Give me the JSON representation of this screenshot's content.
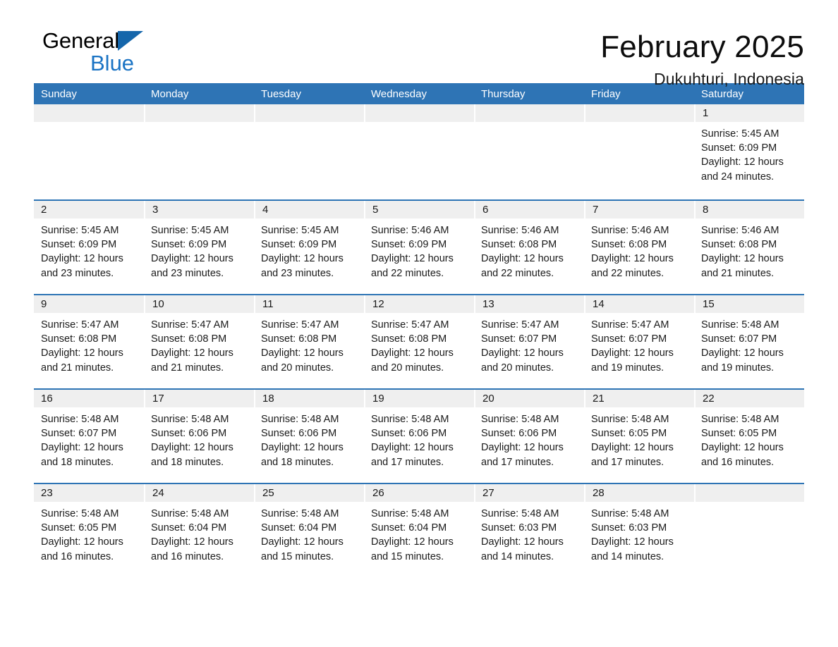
{
  "brand": {
    "name_part1": "General",
    "name_part2": "Blue",
    "triangle_color": "#1566ab",
    "blue_color": "#1a73c4"
  },
  "header": {
    "title": "February 2025",
    "subtitle": "Dukuhturi, Indonesia"
  },
  "theme": {
    "header_blue": "#2e74b5",
    "date_strip_gray": "#efefef",
    "text": "#1a1a1a"
  },
  "weekdays": [
    "Sunday",
    "Monday",
    "Tuesday",
    "Wednesday",
    "Thursday",
    "Friday",
    "Saturday"
  ],
  "labels": {
    "sunrise_prefix": "Sunrise:",
    "sunset_prefix": "Sunset:",
    "daylight_prefix": "Daylight:"
  },
  "weeks": [
    [
      {
        "date": "",
        "empty": true
      },
      {
        "date": "",
        "empty": true
      },
      {
        "date": "",
        "empty": true
      },
      {
        "date": "",
        "empty": true
      },
      {
        "date": "",
        "empty": true
      },
      {
        "date": "",
        "empty": true
      },
      {
        "date": "1",
        "sunrise": "Sunrise: 5:45 AM",
        "sunset": "Sunset: 6:09 PM",
        "daylight1": "Daylight: 12 hours",
        "daylight2": "and 24 minutes."
      }
    ],
    [
      {
        "date": "2",
        "sunrise": "Sunrise: 5:45 AM",
        "sunset": "Sunset: 6:09 PM",
        "daylight1": "Daylight: 12 hours",
        "daylight2": "and 23 minutes."
      },
      {
        "date": "3",
        "sunrise": "Sunrise: 5:45 AM",
        "sunset": "Sunset: 6:09 PM",
        "daylight1": "Daylight: 12 hours",
        "daylight2": "and 23 minutes."
      },
      {
        "date": "4",
        "sunrise": "Sunrise: 5:45 AM",
        "sunset": "Sunset: 6:09 PM",
        "daylight1": "Daylight: 12 hours",
        "daylight2": "and 23 minutes."
      },
      {
        "date": "5",
        "sunrise": "Sunrise: 5:46 AM",
        "sunset": "Sunset: 6:09 PM",
        "daylight1": "Daylight: 12 hours",
        "daylight2": "and 22 minutes."
      },
      {
        "date": "6",
        "sunrise": "Sunrise: 5:46 AM",
        "sunset": "Sunset: 6:08 PM",
        "daylight1": "Daylight: 12 hours",
        "daylight2": "and 22 minutes."
      },
      {
        "date": "7",
        "sunrise": "Sunrise: 5:46 AM",
        "sunset": "Sunset: 6:08 PM",
        "daylight1": "Daylight: 12 hours",
        "daylight2": "and 22 minutes."
      },
      {
        "date": "8",
        "sunrise": "Sunrise: 5:46 AM",
        "sunset": "Sunset: 6:08 PM",
        "daylight1": "Daylight: 12 hours",
        "daylight2": "and 21 minutes."
      }
    ],
    [
      {
        "date": "9",
        "sunrise": "Sunrise: 5:47 AM",
        "sunset": "Sunset: 6:08 PM",
        "daylight1": "Daylight: 12 hours",
        "daylight2": "and 21 minutes."
      },
      {
        "date": "10",
        "sunrise": "Sunrise: 5:47 AM",
        "sunset": "Sunset: 6:08 PM",
        "daylight1": "Daylight: 12 hours",
        "daylight2": "and 21 minutes."
      },
      {
        "date": "11",
        "sunrise": "Sunrise: 5:47 AM",
        "sunset": "Sunset: 6:08 PM",
        "daylight1": "Daylight: 12 hours",
        "daylight2": "and 20 minutes."
      },
      {
        "date": "12",
        "sunrise": "Sunrise: 5:47 AM",
        "sunset": "Sunset: 6:08 PM",
        "daylight1": "Daylight: 12 hours",
        "daylight2": "and 20 minutes."
      },
      {
        "date": "13",
        "sunrise": "Sunrise: 5:47 AM",
        "sunset": "Sunset: 6:07 PM",
        "daylight1": "Daylight: 12 hours",
        "daylight2": "and 20 minutes."
      },
      {
        "date": "14",
        "sunrise": "Sunrise: 5:47 AM",
        "sunset": "Sunset: 6:07 PM",
        "daylight1": "Daylight: 12 hours",
        "daylight2": "and 19 minutes."
      },
      {
        "date": "15",
        "sunrise": "Sunrise: 5:48 AM",
        "sunset": "Sunset: 6:07 PM",
        "daylight1": "Daylight: 12 hours",
        "daylight2": "and 19 minutes."
      }
    ],
    [
      {
        "date": "16",
        "sunrise": "Sunrise: 5:48 AM",
        "sunset": "Sunset: 6:07 PM",
        "daylight1": "Daylight: 12 hours",
        "daylight2": "and 18 minutes."
      },
      {
        "date": "17",
        "sunrise": "Sunrise: 5:48 AM",
        "sunset": "Sunset: 6:06 PM",
        "daylight1": "Daylight: 12 hours",
        "daylight2": "and 18 minutes."
      },
      {
        "date": "18",
        "sunrise": "Sunrise: 5:48 AM",
        "sunset": "Sunset: 6:06 PM",
        "daylight1": "Daylight: 12 hours",
        "daylight2": "and 18 minutes."
      },
      {
        "date": "19",
        "sunrise": "Sunrise: 5:48 AM",
        "sunset": "Sunset: 6:06 PM",
        "daylight1": "Daylight: 12 hours",
        "daylight2": "and 17 minutes."
      },
      {
        "date": "20",
        "sunrise": "Sunrise: 5:48 AM",
        "sunset": "Sunset: 6:06 PM",
        "daylight1": "Daylight: 12 hours",
        "daylight2": "and 17 minutes."
      },
      {
        "date": "21",
        "sunrise": "Sunrise: 5:48 AM",
        "sunset": "Sunset: 6:05 PM",
        "daylight1": "Daylight: 12 hours",
        "daylight2": "and 17 minutes."
      },
      {
        "date": "22",
        "sunrise": "Sunrise: 5:48 AM",
        "sunset": "Sunset: 6:05 PM",
        "daylight1": "Daylight: 12 hours",
        "daylight2": "and 16 minutes."
      }
    ],
    [
      {
        "date": "23",
        "sunrise": "Sunrise: 5:48 AM",
        "sunset": "Sunset: 6:05 PM",
        "daylight1": "Daylight: 12 hours",
        "daylight2": "and 16 minutes."
      },
      {
        "date": "24",
        "sunrise": "Sunrise: 5:48 AM",
        "sunset": "Sunset: 6:04 PM",
        "daylight1": "Daylight: 12 hours",
        "daylight2": "and 16 minutes."
      },
      {
        "date": "25",
        "sunrise": "Sunrise: 5:48 AM",
        "sunset": "Sunset: 6:04 PM",
        "daylight1": "Daylight: 12 hours",
        "daylight2": "and 15 minutes."
      },
      {
        "date": "26",
        "sunrise": "Sunrise: 5:48 AM",
        "sunset": "Sunset: 6:04 PM",
        "daylight1": "Daylight: 12 hours",
        "daylight2": "and 15 minutes."
      },
      {
        "date": "27",
        "sunrise": "Sunrise: 5:48 AM",
        "sunset": "Sunset: 6:03 PM",
        "daylight1": "Daylight: 12 hours",
        "daylight2": "and 14 minutes."
      },
      {
        "date": "28",
        "sunrise": "Sunrise: 5:48 AM",
        "sunset": "Sunset: 6:03 PM",
        "daylight1": "Daylight: 12 hours",
        "daylight2": "and 14 minutes."
      },
      {
        "date": "",
        "empty": true,
        "trailing": true
      }
    ]
  ]
}
